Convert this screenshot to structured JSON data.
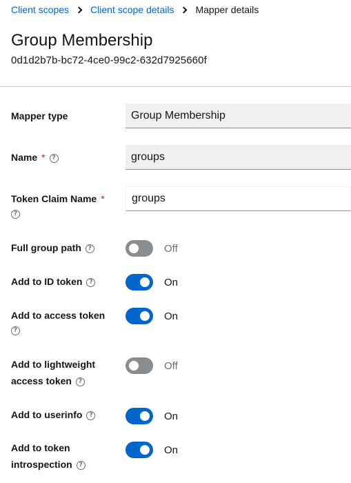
{
  "breadcrumb": {
    "items": [
      "Client scopes",
      "Client scope details"
    ],
    "current": "Mapper details"
  },
  "header": {
    "title": "Group Membership",
    "id": "0d1d2b7b-bc72-4ce0-99c2-632d7925660f"
  },
  "help_glyph": "?",
  "form": {
    "mapper_type": {
      "label": "Mapper type",
      "value": "Group Membership"
    },
    "name": {
      "label": "Name",
      "required": "*",
      "value": "groups"
    },
    "token_claim_name": {
      "label": "Token Claim Name",
      "required": "*",
      "value": "groups"
    },
    "full_group_path": {
      "label": "Full group path",
      "state": "Off"
    },
    "add_to_id_token": {
      "label": "Add to ID token",
      "state": "On"
    },
    "add_to_access_token": {
      "label": "Add to access token",
      "state": "On"
    },
    "add_to_lightweight": {
      "label_line1": "Add to lightweight",
      "label_line2": "access token",
      "state": "Off"
    },
    "add_to_userinfo": {
      "label": "Add to userinfo",
      "state": "On"
    },
    "add_to_introspection": {
      "label_line1": "Add to token",
      "label_line2": "introspection",
      "state": "On"
    }
  },
  "colors": {
    "link": "#0066cc",
    "switch_on": "#0066cc",
    "switch_off": "#8a8d90",
    "required": "#c9190b"
  }
}
